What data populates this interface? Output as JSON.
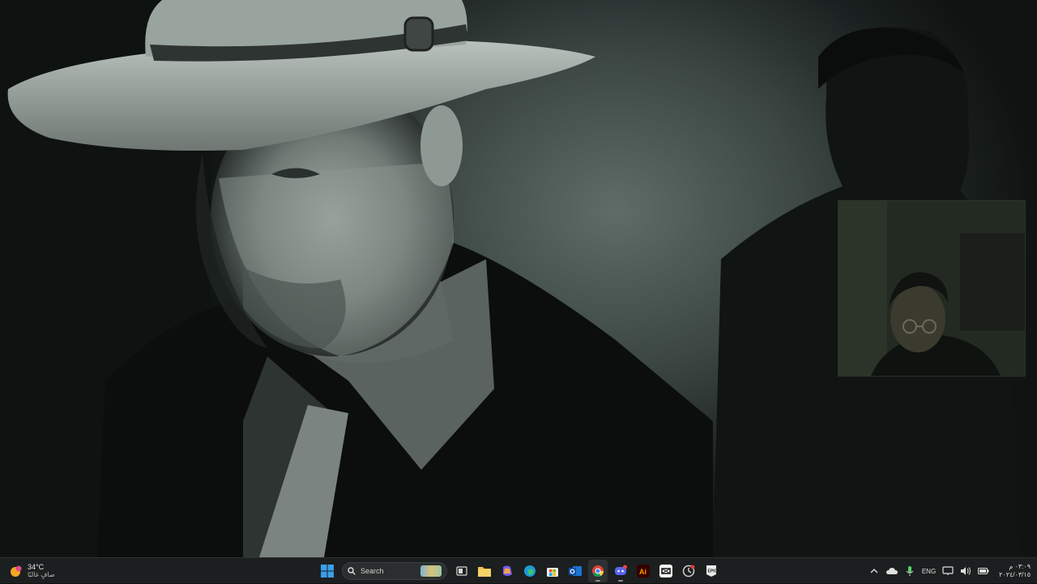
{
  "weather": {
    "temperature": "34°C",
    "condition": "صافٍ غالبًا"
  },
  "taskbar": {
    "search_label": "Search",
    "apps": [
      {
        "name": "task-view-icon"
      },
      {
        "name": "file-explorer-icon"
      },
      {
        "name": "copilot-icon"
      },
      {
        "name": "edge-browser-icon"
      },
      {
        "name": "microsoft-store-icon"
      },
      {
        "name": "outlook-icon"
      },
      {
        "name": "chrome-icon"
      },
      {
        "name": "discord-icon"
      },
      {
        "name": "illustrator-icon"
      },
      {
        "name": "capcut-icon"
      },
      {
        "name": "activity-app-icon"
      },
      {
        "name": "epic-games-icon"
      }
    ]
  },
  "tray": {
    "language": "ENG",
    "time": "٠٣:٠٩ م",
    "date": "٢٠٢٤/٠٣/١٥"
  },
  "colors": {
    "taskbar_bg": "#1c1f1f",
    "windows_blue": "#3a9ee8",
    "illustrator_orange": "#ff9a00",
    "chrome_red": "#db4437"
  }
}
